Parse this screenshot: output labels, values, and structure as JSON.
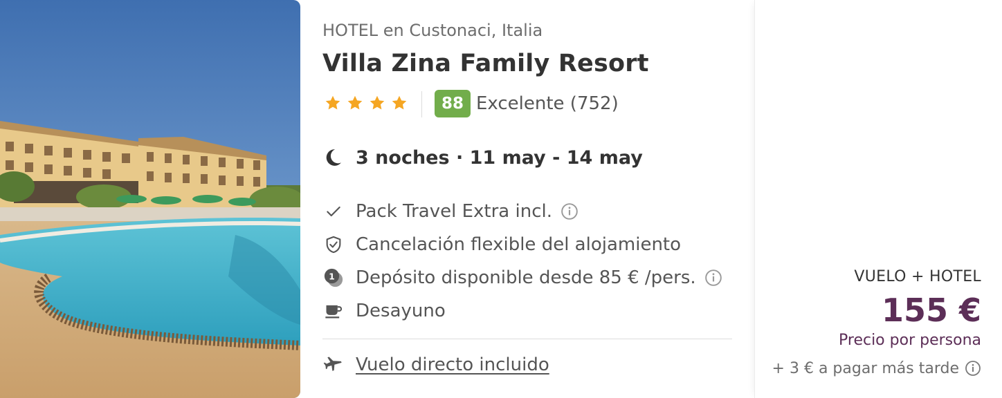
{
  "hotel": {
    "location": "HOTEL en Custonaci, Italia",
    "name": "Villa Zina Family Resort",
    "stars": 4,
    "score": "88",
    "score_text": "Excelente (752)"
  },
  "stay": {
    "summary": "3 noches · 11 may - 14 may"
  },
  "features": [
    {
      "icon": "check-icon",
      "label": "Pack Travel Extra incl.",
      "has_info": true
    },
    {
      "icon": "shield-check-icon",
      "label": "Cancelación flexible del alojamiento",
      "has_info": false
    },
    {
      "icon": "coin-icon",
      "label": "Depósito disponible desde 85 € /pers.",
      "has_info": true
    },
    {
      "icon": "coffee-cup-icon",
      "label": "Desayuno",
      "has_info": false
    }
  ],
  "flight": {
    "icon": "airplane-icon",
    "label": "Vuelo directo incluido"
  },
  "pricing": {
    "package_type": "VUELO + HOTEL",
    "price": "155 €",
    "price_note": "Precio por persona",
    "extra_fee": "+ 3 € a pagar más tarde"
  },
  "colors": {
    "star": "#f5a623",
    "score_badge": "#72ad4b",
    "price": "#5c2e57",
    "icon": "#555555"
  }
}
